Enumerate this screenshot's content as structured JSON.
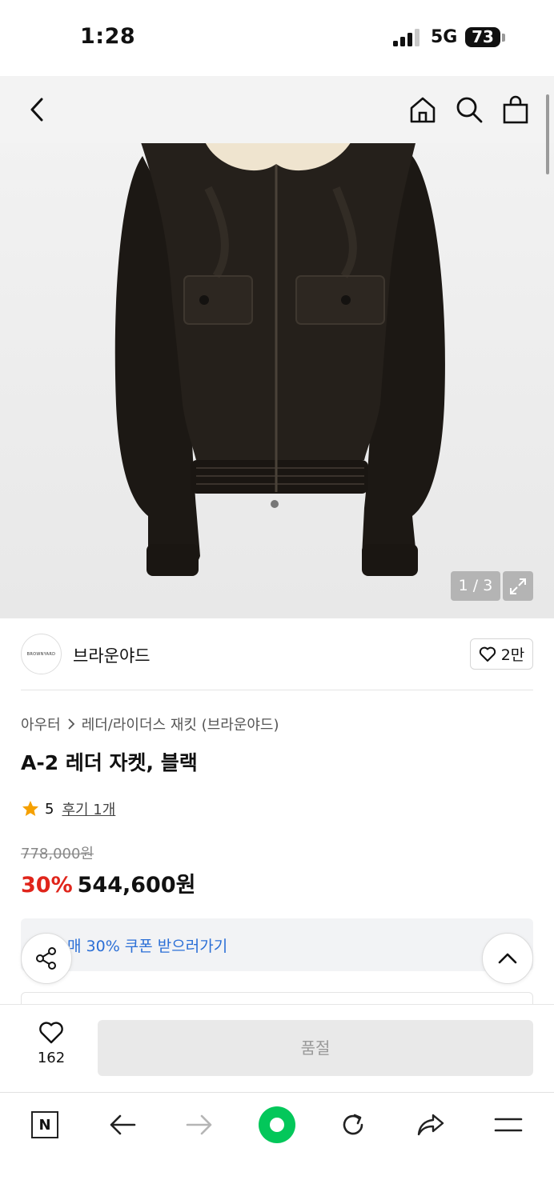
{
  "status": {
    "time": "1:28",
    "network": "5G",
    "battery": "73"
  },
  "gallery": {
    "counter": "1 / 3"
  },
  "brand": {
    "logo_text": "BROWNYARD",
    "name": "브라운야드",
    "likes": "2만"
  },
  "breadcrumb": {
    "category": "아우터",
    "subcategory": "레더/라이더스 재킷 (브라운야드)"
  },
  "product": {
    "title": "A-2 레더 자켓, 블랙",
    "rating": "5",
    "review_link": "후기 1개",
    "original_price": "778,000원",
    "discount": "30%",
    "price": "544,600원"
  },
  "coupon": {
    "text": "매 30% 쿠폰 받으러가기"
  },
  "purchase": {
    "wish_count": "162",
    "soldout_label": "품절"
  },
  "toolbar": {
    "naver_label": "N"
  },
  "colors": {
    "discount": "#e0251b",
    "coupon": "#2b6fd6",
    "naver_green": "#03c75a"
  }
}
